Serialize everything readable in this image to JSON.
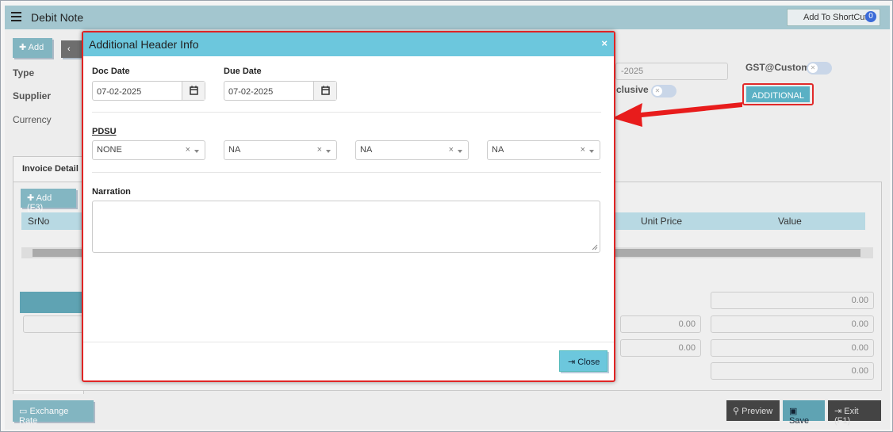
{
  "app": {
    "title": "Debit Note",
    "shortcut_label": "Add To ShortCut",
    "shortcut_count": "0"
  },
  "background": {
    "add_label": "Add",
    "type_label": "Type",
    "supplier_label": "Supplier",
    "currency_label": "Currency",
    "date_value": "-2025",
    "gst_label": "GST@Custom",
    "inclusive_label": "clusive",
    "additional_label": "ADDITIONAL",
    "invoice_tab": "Invoice Detail",
    "add_f3_label": "Add (F3)",
    "grid_srno": "SrNo",
    "grid_unit_price": "Unit Price",
    "grid_value": "Value",
    "totals": [
      "0.00",
      "0.00",
      "0.00",
      "0.00"
    ],
    "mid_totals": [
      "0.00",
      "0.00"
    ],
    "exchange_label": "Exchange Rate",
    "preview_label": "Preview",
    "save_label": "Save",
    "exit_label": "Exit (F1)"
  },
  "modal": {
    "title": "Additional Header Info",
    "close_x": "×",
    "doc_date_label": "Doc Date",
    "doc_date_value": "07-02-2025",
    "due_date_label": "Due Date",
    "due_date_value": "07-02-2025",
    "pdsu_label": "PDSU",
    "selects": [
      "NONE",
      "NA",
      "NA",
      "NA"
    ],
    "clear_glyph": "×",
    "narration_label": "Narration",
    "narration_value": "",
    "close_label": "Close"
  },
  "colors": {
    "header_teal": "#6cc7dd",
    "highlight_red": "#e02424",
    "topbar": "#a3c6cf"
  }
}
